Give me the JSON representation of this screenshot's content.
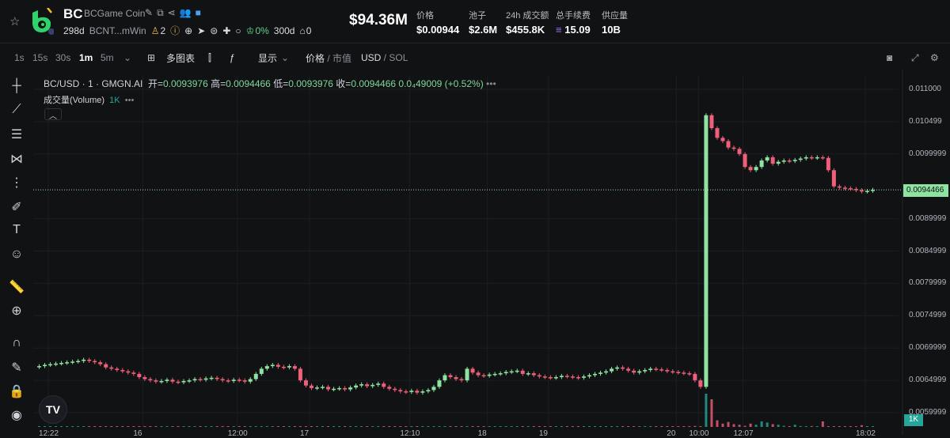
{
  "header": {
    "symbol": "BC",
    "name": "BCGame Coin",
    "age": "298d",
    "address": "BCNT...mWin",
    "holders": "2",
    "top_pct": "0%",
    "top_age": "300d",
    "bot_count": "0",
    "market_cap": "$94.36M",
    "stats": [
      {
        "label": "价格",
        "value": "$0.00944"
      },
      {
        "label": "池子",
        "value": "$2.6M"
      },
      {
        "label": "24h 成交额",
        "value": "$455.8K"
      },
      {
        "label": "总手续费",
        "value": "15.09"
      },
      {
        "label": "供应量",
        "value": "10B"
      }
    ]
  },
  "toolbar": {
    "intervals": [
      "1s",
      "15s",
      "30s",
      "1m",
      "5m"
    ],
    "active_interval": "1m",
    "multi_chart": "多图表",
    "display": "显示",
    "price_label": "价格",
    "mcap_label": "市值",
    "usd": "USD",
    "sol": "SOL"
  },
  "legend": {
    "title": "BC/USD · 1 · GMGN.AI",
    "open_l": "开=",
    "open": "0.0093976",
    "high_l": "高=",
    "high": "0.0094466",
    "low_l": "低=",
    "low": "0.0093976",
    "close_l": "收=",
    "close": "0.0094466",
    "change": "0.0₄49009 (+0.52%)",
    "volume_label": "成交量(Volume)",
    "volume_value": "1K"
  },
  "colors": {
    "up": "#26a69a",
    "up_body": "#8ee3a0",
    "down": "#ef5f7a",
    "bg": "#111214",
    "grid": "#1c1e23"
  },
  "chart_data": {
    "type": "candlestick",
    "ylim": [
      0.0058,
      0.0112
    ],
    "y_ticks": [
      "0.011000",
      "0.010499",
      "0.0099999",
      "0.0089999",
      "0.0084999",
      "0.0079999",
      "0.0074999",
      "0.0069999",
      "0.0064999",
      "0.0059999"
    ],
    "y_tick_values": [
      0.011,
      0.010499,
      0.0099999,
      0.0089999,
      0.0084999,
      0.0079999,
      0.0074999,
      0.0069999,
      0.0064999,
      0.0059999
    ],
    "x_ticks": [
      "12:22",
      "16",
      "12:00",
      "17",
      "12:10",
      "18",
      "19",
      "20",
      "10:00",
      "12:07",
      "18:02"
    ],
    "x_tick_index": [
      2,
      19,
      36,
      49,
      67,
      81,
      92,
      115,
      119,
      127,
      149
    ],
    "current_price": "0.0094466",
    "current_value": 0.0094466,
    "volume_tag": "1K",
    "closes": [
      0.00672,
      0.00674,
      0.00675,
      0.00676,
      0.00677,
      0.00678,
      0.00679,
      0.0068,
      0.00682,
      0.0068,
      0.00678,
      0.00675,
      0.0067,
      0.00668,
      0.00666,
      0.00664,
      0.00662,
      0.0066,
      0.00655,
      0.00652,
      0.0065,
      0.00648,
      0.00649,
      0.00651,
      0.00648,
      0.00647,
      0.00649,
      0.0065,
      0.00652,
      0.00651,
      0.00653,
      0.00654,
      0.00652,
      0.0065,
      0.00649,
      0.00651,
      0.0065,
      0.00648,
      0.00652,
      0.0066,
      0.00668,
      0.00672,
      0.00674,
      0.00671,
      0.0067,
      0.00672,
      0.00668,
      0.0065,
      0.00642,
      0.00638,
      0.00639,
      0.0064,
      0.00636,
      0.00637,
      0.00638,
      0.00636,
      0.00639,
      0.00642,
      0.00644,
      0.00641,
      0.00643,
      0.00645,
      0.0064,
      0.00637,
      0.00635,
      0.00633,
      0.00632,
      0.00634,
      0.00631,
      0.00633,
      0.00635,
      0.0064,
      0.0065,
      0.00658,
      0.00655,
      0.00652,
      0.0065,
      0.00668,
      0.00662,
      0.00658,
      0.00657,
      0.00659,
      0.0066,
      0.00661,
      0.00663,
      0.00664,
      0.00665,
      0.0066,
      0.00661,
      0.00658,
      0.00656,
      0.00655,
      0.00654,
      0.00655,
      0.00657,
      0.00656,
      0.00655,
      0.00654,
      0.00656,
      0.00658,
      0.0066,
      0.00662,
      0.00664,
      0.00668,
      0.0067,
      0.00668,
      0.00665,
      0.00662,
      0.00664,
      0.00666,
      0.00668,
      0.00667,
      0.00666,
      0.00664,
      0.00663,
      0.00662,
      0.00661,
      0.0066,
      0.0065,
      0.0064,
      0.0106,
      0.0104,
      0.01025,
      0.0102,
      0.0101,
      0.01008,
      0.01,
      0.0098,
      0.00975,
      0.0098,
      0.0099,
      0.00995,
      0.00985,
      0.00988,
      0.0099,
      0.00989,
      0.00991,
      0.00993,
      0.00995,
      0.00994,
      0.00995,
      0.00994,
      0.00975,
      0.0095,
      0.00948,
      0.00947,
      0.00946,
      0.00944,
      0.00942,
      0.00943,
      0.0094466
    ],
    "volumes": [
      20,
      20,
      20,
      30,
      20,
      20,
      20,
      30,
      20,
      20,
      20,
      20,
      20,
      20,
      30,
      20,
      20,
      20,
      20,
      20,
      20,
      30,
      20,
      20,
      20,
      20,
      50,
      20,
      20,
      20,
      20,
      30,
      20,
      20,
      20,
      20,
      20,
      20,
      30,
      20,
      20,
      60,
      30,
      20,
      20,
      40,
      30,
      20,
      20,
      20,
      20,
      20,
      20,
      20,
      30,
      40,
      20,
      20,
      20,
      20,
      20,
      20,
      20,
      20,
      20,
      40,
      30,
      20,
      20,
      30,
      30,
      20,
      40,
      20,
      20,
      20,
      20,
      30,
      20,
      20,
      20,
      30,
      20,
      20,
      20,
      40,
      20,
      20,
      20,
      20,
      20,
      20,
      20,
      30,
      20,
      20,
      20,
      20,
      20,
      60,
      20,
      20,
      20,
      20,
      30,
      20,
      40,
      20,
      20,
      20,
      20,
      20,
      20,
      20,
      20,
      20,
      30,
      20,
      90,
      40,
      3000,
      2500,
      600,
      300,
      450,
      250,
      200,
      100,
      300,
      200,
      500,
      400,
      250,
      200,
      100,
      50,
      200,
      80,
      60,
      80,
      40,
      500,
      30,
      40,
      60,
      40,
      40,
      30,
      160,
      40,
      50
    ]
  }
}
